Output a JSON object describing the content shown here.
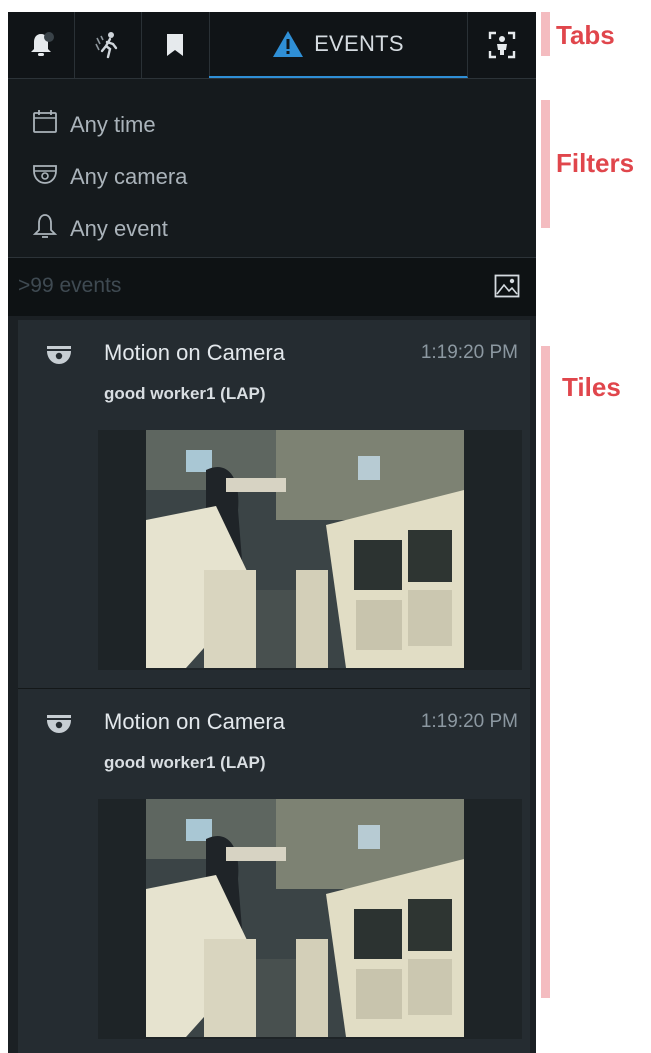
{
  "tabs": {
    "items": [
      {
        "name": "notifications",
        "icon": "bell-icon"
      },
      {
        "name": "motion",
        "icon": "walking-person-icon"
      },
      {
        "name": "bookmarks",
        "icon": "bookmark-icon"
      },
      {
        "name": "events",
        "icon": "warning-triangle-icon",
        "label": "EVENTS",
        "active": true
      },
      {
        "name": "objects",
        "icon": "person-frame-icon"
      }
    ]
  },
  "filters": {
    "time": "Any time",
    "camera": "Any camera",
    "event": "Any event"
  },
  "events": {
    "count_label": ">99 events",
    "tiles": [
      {
        "title": "Motion on Camera",
        "time": "1:19:20 PM",
        "camera": "good worker1 (LAP)"
      },
      {
        "title": "Motion on Camera",
        "time": "1:19:20 PM",
        "camera": "good worker1 (LAP)"
      }
    ]
  },
  "annotations": {
    "tabs": "Tabs",
    "filters": "Filters",
    "tiles": "Tiles"
  },
  "colors": {
    "accent": "#2f8fd6",
    "annotation": "#e0464c",
    "annotation_bar": "#f4bcc0"
  }
}
